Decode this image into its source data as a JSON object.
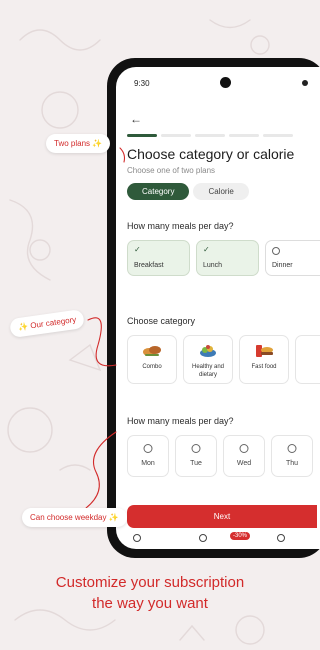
{
  "status": {
    "time": "9:30"
  },
  "header": {
    "title": "Choose category or calorie",
    "subtitle": "Choose one of two plans",
    "progress_total": 5,
    "progress_done": 1
  },
  "plan_toggle": {
    "options": [
      "Category",
      "Calorie"
    ],
    "selected": "Category"
  },
  "meals_section": {
    "label": "How many meals per day?",
    "items": [
      {
        "label": "Breakfast",
        "selected": true
      },
      {
        "label": "Lunch",
        "selected": true
      },
      {
        "label": "Dinner",
        "selected": false
      }
    ]
  },
  "category_section": {
    "label": "Choose category",
    "items": [
      {
        "label": "Combo",
        "icon": "combo-food-icon"
      },
      {
        "label": "Healthy and dietary",
        "icon": "healthy-food-icon"
      },
      {
        "label": "Fast food",
        "icon": "fast-food-icon"
      }
    ]
  },
  "days_section": {
    "label": "How many meals per day?",
    "items": [
      "Mon",
      "Tue",
      "Wed",
      "Thu"
    ]
  },
  "next_button": {
    "label": "Next"
  },
  "bottom": {
    "discount": "-30%"
  },
  "callouts": {
    "two_plans": "Two plans",
    "our_category": "Our category",
    "weekday": "Can choose weekday",
    "spark": "✨"
  },
  "caption": {
    "line1": "Customize your subscription",
    "line2": "the way you want"
  },
  "colors": {
    "brand_red": "#d52e2e",
    "brand_green": "#2f5a3b",
    "background": "#f3eeee"
  }
}
